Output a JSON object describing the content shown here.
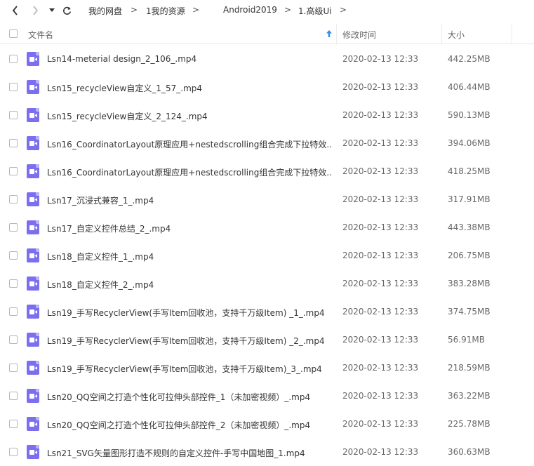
{
  "toolbar": {
    "back_icon": "chevron-left-icon",
    "forward_icon": "chevron-right-icon",
    "history_icon": "caret-down-icon",
    "refresh_icon": "refresh-icon",
    "breadcrumbs": [
      "我的网盘",
      "1我的资源",
      "Android2019",
      "1.高级Ui"
    ],
    "separator": ">"
  },
  "header": {
    "name": "文件名",
    "modified": "修改时间",
    "size": "大小",
    "sort_icon": "sort-up-arrow-icon"
  },
  "files": [
    {
      "name": "Lsn14-meterial design_2_106_.mp4",
      "modified": "2020-02-13 12:33",
      "size": "442.25MB"
    },
    {
      "name": "Lsn15_recycleView自定义_1_57_.mp4",
      "modified": "2020-02-13 12:33",
      "size": "406.44MB"
    },
    {
      "name": "Lsn15_recycleView自定义_2_124_.mp4",
      "modified": "2020-02-13 12:33",
      "size": "590.13MB"
    },
    {
      "name": "Lsn16_CoordinatorLayout原理应用+nestedscrolling组合完成下拉特效...",
      "modified": "2020-02-13 12:33",
      "size": "394.06MB"
    },
    {
      "name": "Lsn16_CoordinatorLayout原理应用+nestedscrolling组合完成下拉特效...",
      "modified": "2020-02-13 12:33",
      "size": "418.25MB"
    },
    {
      "name": "Lsn17_沉浸式兼容_1_.mp4",
      "modified": "2020-02-13 12:33",
      "size": "317.91MB"
    },
    {
      "name": "Lsn17_自定义控件总结_2_.mp4",
      "modified": "2020-02-13 12:33",
      "size": "443.38MB"
    },
    {
      "name": "Lsn18_自定义控件_1_.mp4",
      "modified": "2020-02-13 12:33",
      "size": "206.75MB"
    },
    {
      "name": "Lsn18_自定义控件_2_.mp4",
      "modified": "2020-02-13 12:33",
      "size": "383.28MB"
    },
    {
      "name": "Lsn19_手写RecyclerView(手写Item回收池，支持千万级Item) _1_.mp4",
      "modified": "2020-02-13 12:33",
      "size": "374.75MB"
    },
    {
      "name": "Lsn19_手写RecyclerView(手写Item回收池，支持千万级Item) _2_.mp4",
      "modified": "2020-02-13 12:33",
      "size": "56.91MB"
    },
    {
      "name": "Lsn19_手写RecyclerView(手写Item回收池，支持千万级Item)_3_.mp4",
      "modified": "2020-02-13 12:33",
      "size": "218.59MB"
    },
    {
      "name": "Lsn20_QQ空间之打造个性化可拉伸头部控件_1（未加密视频）_.mp4",
      "modified": "2020-02-13 12:33",
      "size": "363.22MB"
    },
    {
      "name": "Lsn20_QQ空间之打造个性化可拉伸头部控件_2（未加密视频）_.mp4",
      "modified": "2020-02-13 12:33",
      "size": "225.78MB"
    },
    {
      "name": "Lsn21_SVG矢量图形打造不规则的自定义控件-手写中国地图_1.mp4",
      "modified": "2020-02-13 12:33",
      "size": "360.63MB"
    }
  ],
  "file_icon": "video-file-icon",
  "colors": {
    "file_icon": "#7b6ff0",
    "sort_arrow": "#2f8cf0"
  }
}
